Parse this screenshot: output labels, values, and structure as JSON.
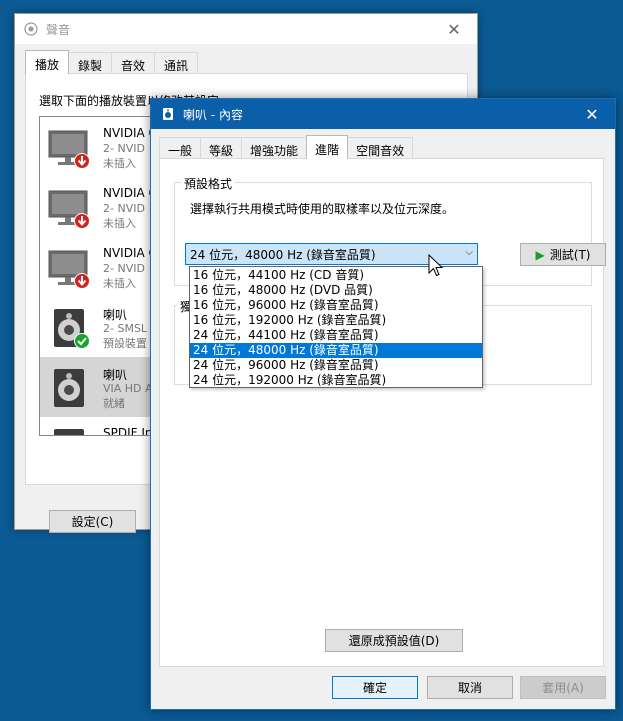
{
  "sound_window": {
    "title": "聲音",
    "tabs": [
      {
        "label": "播放",
        "active": true
      },
      {
        "label": "錄製",
        "active": false
      },
      {
        "label": "音效",
        "active": false
      },
      {
        "label": "通訊",
        "active": false
      }
    ],
    "instruction": "選取下面的播放裝置以修改其設定:",
    "devices": [
      {
        "name": "NVIDIA O",
        "detail": "2- NVID",
        "status": "未插入",
        "icon": "monitor-icon",
        "badge": "disconnected-icon"
      },
      {
        "name": "NVIDIA O",
        "detail": "2- NVID",
        "status": "未插入",
        "icon": "monitor-icon",
        "badge": "disconnected-icon"
      },
      {
        "name": "NVIDIA O",
        "detail": "2- NVID",
        "status": "未插入",
        "icon": "monitor-icon",
        "badge": "disconnected-icon"
      },
      {
        "name": "喇叭",
        "detail": "2- SMSL",
        "status": "預設裝置",
        "icon": "speaker-icon",
        "badge": "default-check-icon"
      },
      {
        "name": "喇叭",
        "detail": "VIA HD A",
        "status": "就緒",
        "icon": "speaker-icon",
        "badge": ""
      },
      {
        "name": "SPDIF Int",
        "detail": "",
        "status": "",
        "icon": "spdif-icon",
        "badge": ""
      }
    ],
    "settings_button": "設定(C)"
  },
  "props_window": {
    "title": "喇叭 - 內容",
    "tabs": [
      {
        "label": "一般",
        "active": false
      },
      {
        "label": "等級",
        "active": false
      },
      {
        "label": "增強功能",
        "active": false
      },
      {
        "label": "進階",
        "active": true
      },
      {
        "label": "空間音效",
        "active": false
      }
    ],
    "default_format": {
      "legend": "預設格式",
      "description": "選擇執行共用模式時使用的取樣率以及位元深度。",
      "selected": "24 位元，48000 Hz (錄音室品質)",
      "test_button": "測試(T)"
    },
    "exclusive_legend": "獨",
    "format_options": [
      "16 位元，44100 Hz (CD 音質)",
      "16 位元，48000 Hz (DVD 品質)",
      "16 位元，96000 Hz (錄音室品質)",
      "16 位元，192000 Hz (錄音室品質)",
      "24 位元，44100 Hz (錄音室品質)",
      "24 位元，48000 Hz (錄音室品質)",
      "24 位元，96000 Hz (錄音室品質)",
      "24 位元，192000 Hz (錄音室品質)"
    ],
    "highlighted_option_index": 5,
    "restore_button": "還原成預設值(D)",
    "ok_button": "確定",
    "cancel_button": "取消",
    "apply_button": "套用(A)"
  },
  "colors": {
    "titlebar_active": "#0b5fa8",
    "selection": "#0078d7",
    "combo_focus": "#cce4f7",
    "desktop": "#0b5a94"
  }
}
